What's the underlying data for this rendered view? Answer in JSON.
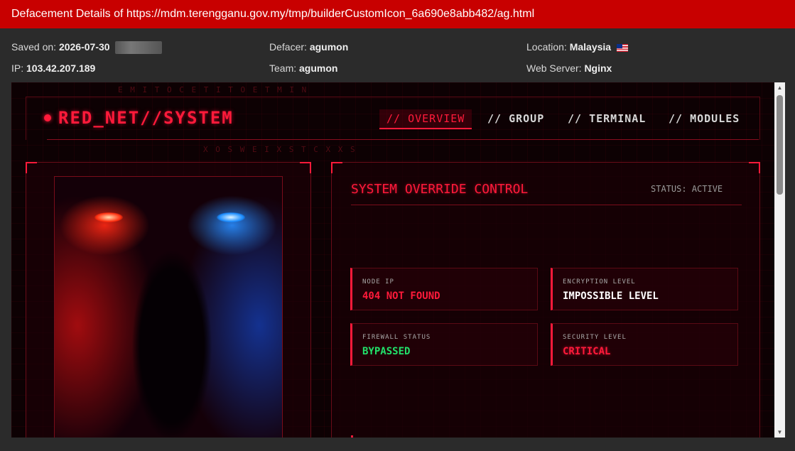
{
  "title": "Defacement Details of https://mdm.terengganu.gov.my/tmp/builderCustomIcon_6a690e8abb482/ag.html",
  "meta": {
    "saved_on_label": "Saved on:",
    "saved_on_value": "2026-07-30",
    "ip_label": "IP:",
    "ip_value": "103.42.207.189",
    "defacer_label": "Defacer:",
    "defacer_value": "agumon",
    "team_label": "Team:",
    "team_value": "agumon",
    "location_label": "Location:",
    "location_value": "Malaysia",
    "webserver_label": "Web Server:",
    "webserver_value": "Nginx"
  },
  "site": {
    "logo": "RED_NET//SYSTEM",
    "nav": [
      {
        "label": "// OVERVIEW",
        "active": true
      },
      {
        "label": "// GROUP",
        "active": false
      },
      {
        "label": "// TERMINAL",
        "active": false
      },
      {
        "label": "// MODULES",
        "active": false
      }
    ],
    "matrix_top": "E M I T O C E T I T O E T M I N",
    "matrix_mid": "X O S W E I X S T C X X S",
    "panel_title": "SYSTEM OVERRIDE CONTROL",
    "panel_status": "STATUS: ACTIVE",
    "cards": [
      {
        "label": "NODE IP",
        "value": "404 NOT FOUND"
      },
      {
        "label": "ENCRYPTION LEVEL",
        "value": "IMPOSSIBLE LEVEL"
      },
      {
        "label": "FIREWALL STATUS",
        "value": "BYPASSED"
      },
      {
        "label": "SECURITY LEVEL",
        "value": "CRITICAL"
      }
    ]
  },
  "colors": {
    "titlebar": "#c80000",
    "accent_red": "#ff1a3a",
    "green": "#22e06a"
  },
  "icons": {
    "flag": "malaysia-flag-icon",
    "logo_dot": "status-dot-icon"
  }
}
